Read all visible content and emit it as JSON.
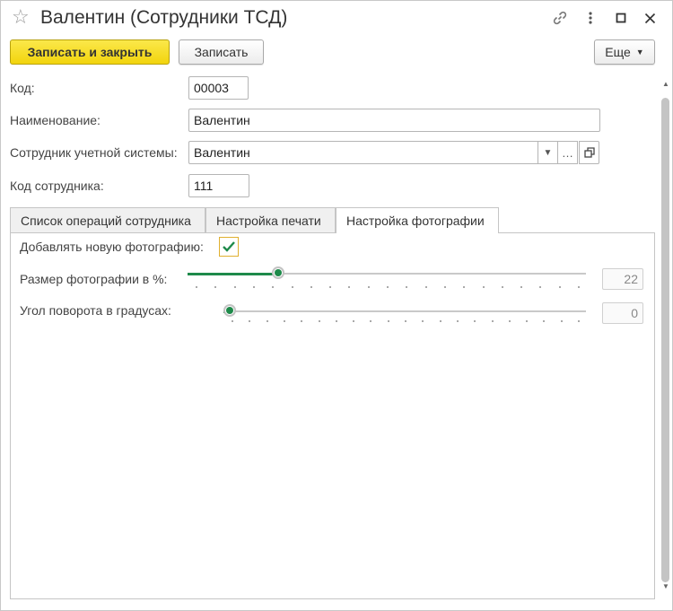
{
  "window": {
    "title": "Валентин (Сотрудники ТСД)"
  },
  "toolbar": {
    "save_close_label": "Записать и закрыть",
    "save_label": "Записать",
    "more_label": "Еще"
  },
  "form": {
    "code_label": "Код:",
    "code_value": "00003",
    "name_label": "Наименование:",
    "name_value": "Валентин",
    "employee_label": "Сотрудник учетной системы:",
    "employee_value": "Валентин",
    "employee_code_label": "Код сотрудника:",
    "employee_code_value": "111"
  },
  "tabs": [
    {
      "label": "Список операций сотрудника",
      "active": false
    },
    {
      "label": "Настройка печати",
      "active": false
    },
    {
      "label": "Настройка фотографии",
      "active": true
    }
  ],
  "photo_settings": {
    "add_photo_label": "Добавлять новую фотографию:",
    "add_photo_checked": true,
    "size_label": "Размер фотографии в %:",
    "size_value": "22",
    "size_fraction": 0.22,
    "angle_label": "Угол поворота в градусах:",
    "angle_value": "0",
    "angle_fraction": 0.0
  },
  "colors": {
    "primary_button": "#f2d40d",
    "accent_green": "#1e8a4a",
    "checkbox_border": "#e0b030"
  },
  "icons": {
    "star": "star-icon",
    "link": "link-icon",
    "menu": "more-vertical-icon",
    "maximize": "maximize-icon",
    "close": "close-icon"
  }
}
